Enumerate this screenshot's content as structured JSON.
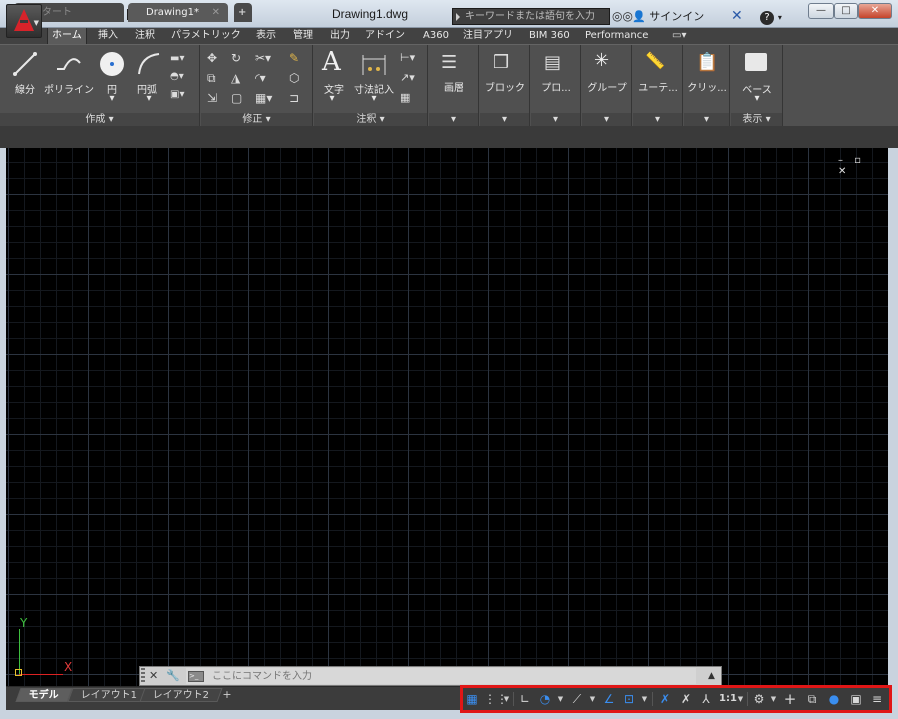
{
  "window": {
    "title": "Drawing1.dwg",
    "minimize": "—",
    "maximize": "□",
    "close": "✕"
  },
  "search": {
    "placeholder": "キーワードまたは語句を入力"
  },
  "account": {
    "signin_label": "サインイン",
    "help_label": "?"
  },
  "ribbon_tabs": [
    "ホーム",
    "挿入",
    "注釈",
    "パラメトリック",
    "表示",
    "管理",
    "出力",
    "アドイン",
    "A360",
    "注目アプリ",
    "BIM 360",
    "Performance"
  ],
  "panels": {
    "draw": {
      "title": "作成 ▾",
      "line": "線分",
      "polyline": "ポリライン",
      "circle": "円",
      "arc": "円弧"
    },
    "modify": {
      "title": "修正 ▾"
    },
    "annotation": {
      "title": "注釈 ▾",
      "text": "文字",
      "dimension": "寸法記入"
    },
    "layers": {
      "title": "画層"
    },
    "block": {
      "title": "ブロック"
    },
    "properties": {
      "title": "プロ..."
    },
    "groups": {
      "title": "グループ"
    },
    "utilities": {
      "title": "ユーテ..."
    },
    "clipboard": {
      "title": "クリッ..."
    },
    "view": {
      "title": "表示 ▾",
      "base": "ベース"
    }
  },
  "file_tabs": {
    "start": "スタート",
    "drawing": "Drawing1*",
    "close": "✕",
    "new": "+"
  },
  "viewport": {
    "controls": "– ▫ ✕"
  },
  "ucs": {
    "x": "X",
    "y": "Y"
  },
  "command_line": {
    "placeholder": "ここにコマンドを入力"
  },
  "layout_tabs": {
    "model": "モデル",
    "layout1": "レイアウト1",
    "layout2": "レイアウト2",
    "new": "+"
  },
  "status_bar": {
    "annotation_scale": "1:1"
  },
  "colors": {
    "highlight": "#e01616",
    "ribbon": "#505050",
    "canvas": "#000000",
    "status_icon_blue": "#3a8ef0"
  }
}
